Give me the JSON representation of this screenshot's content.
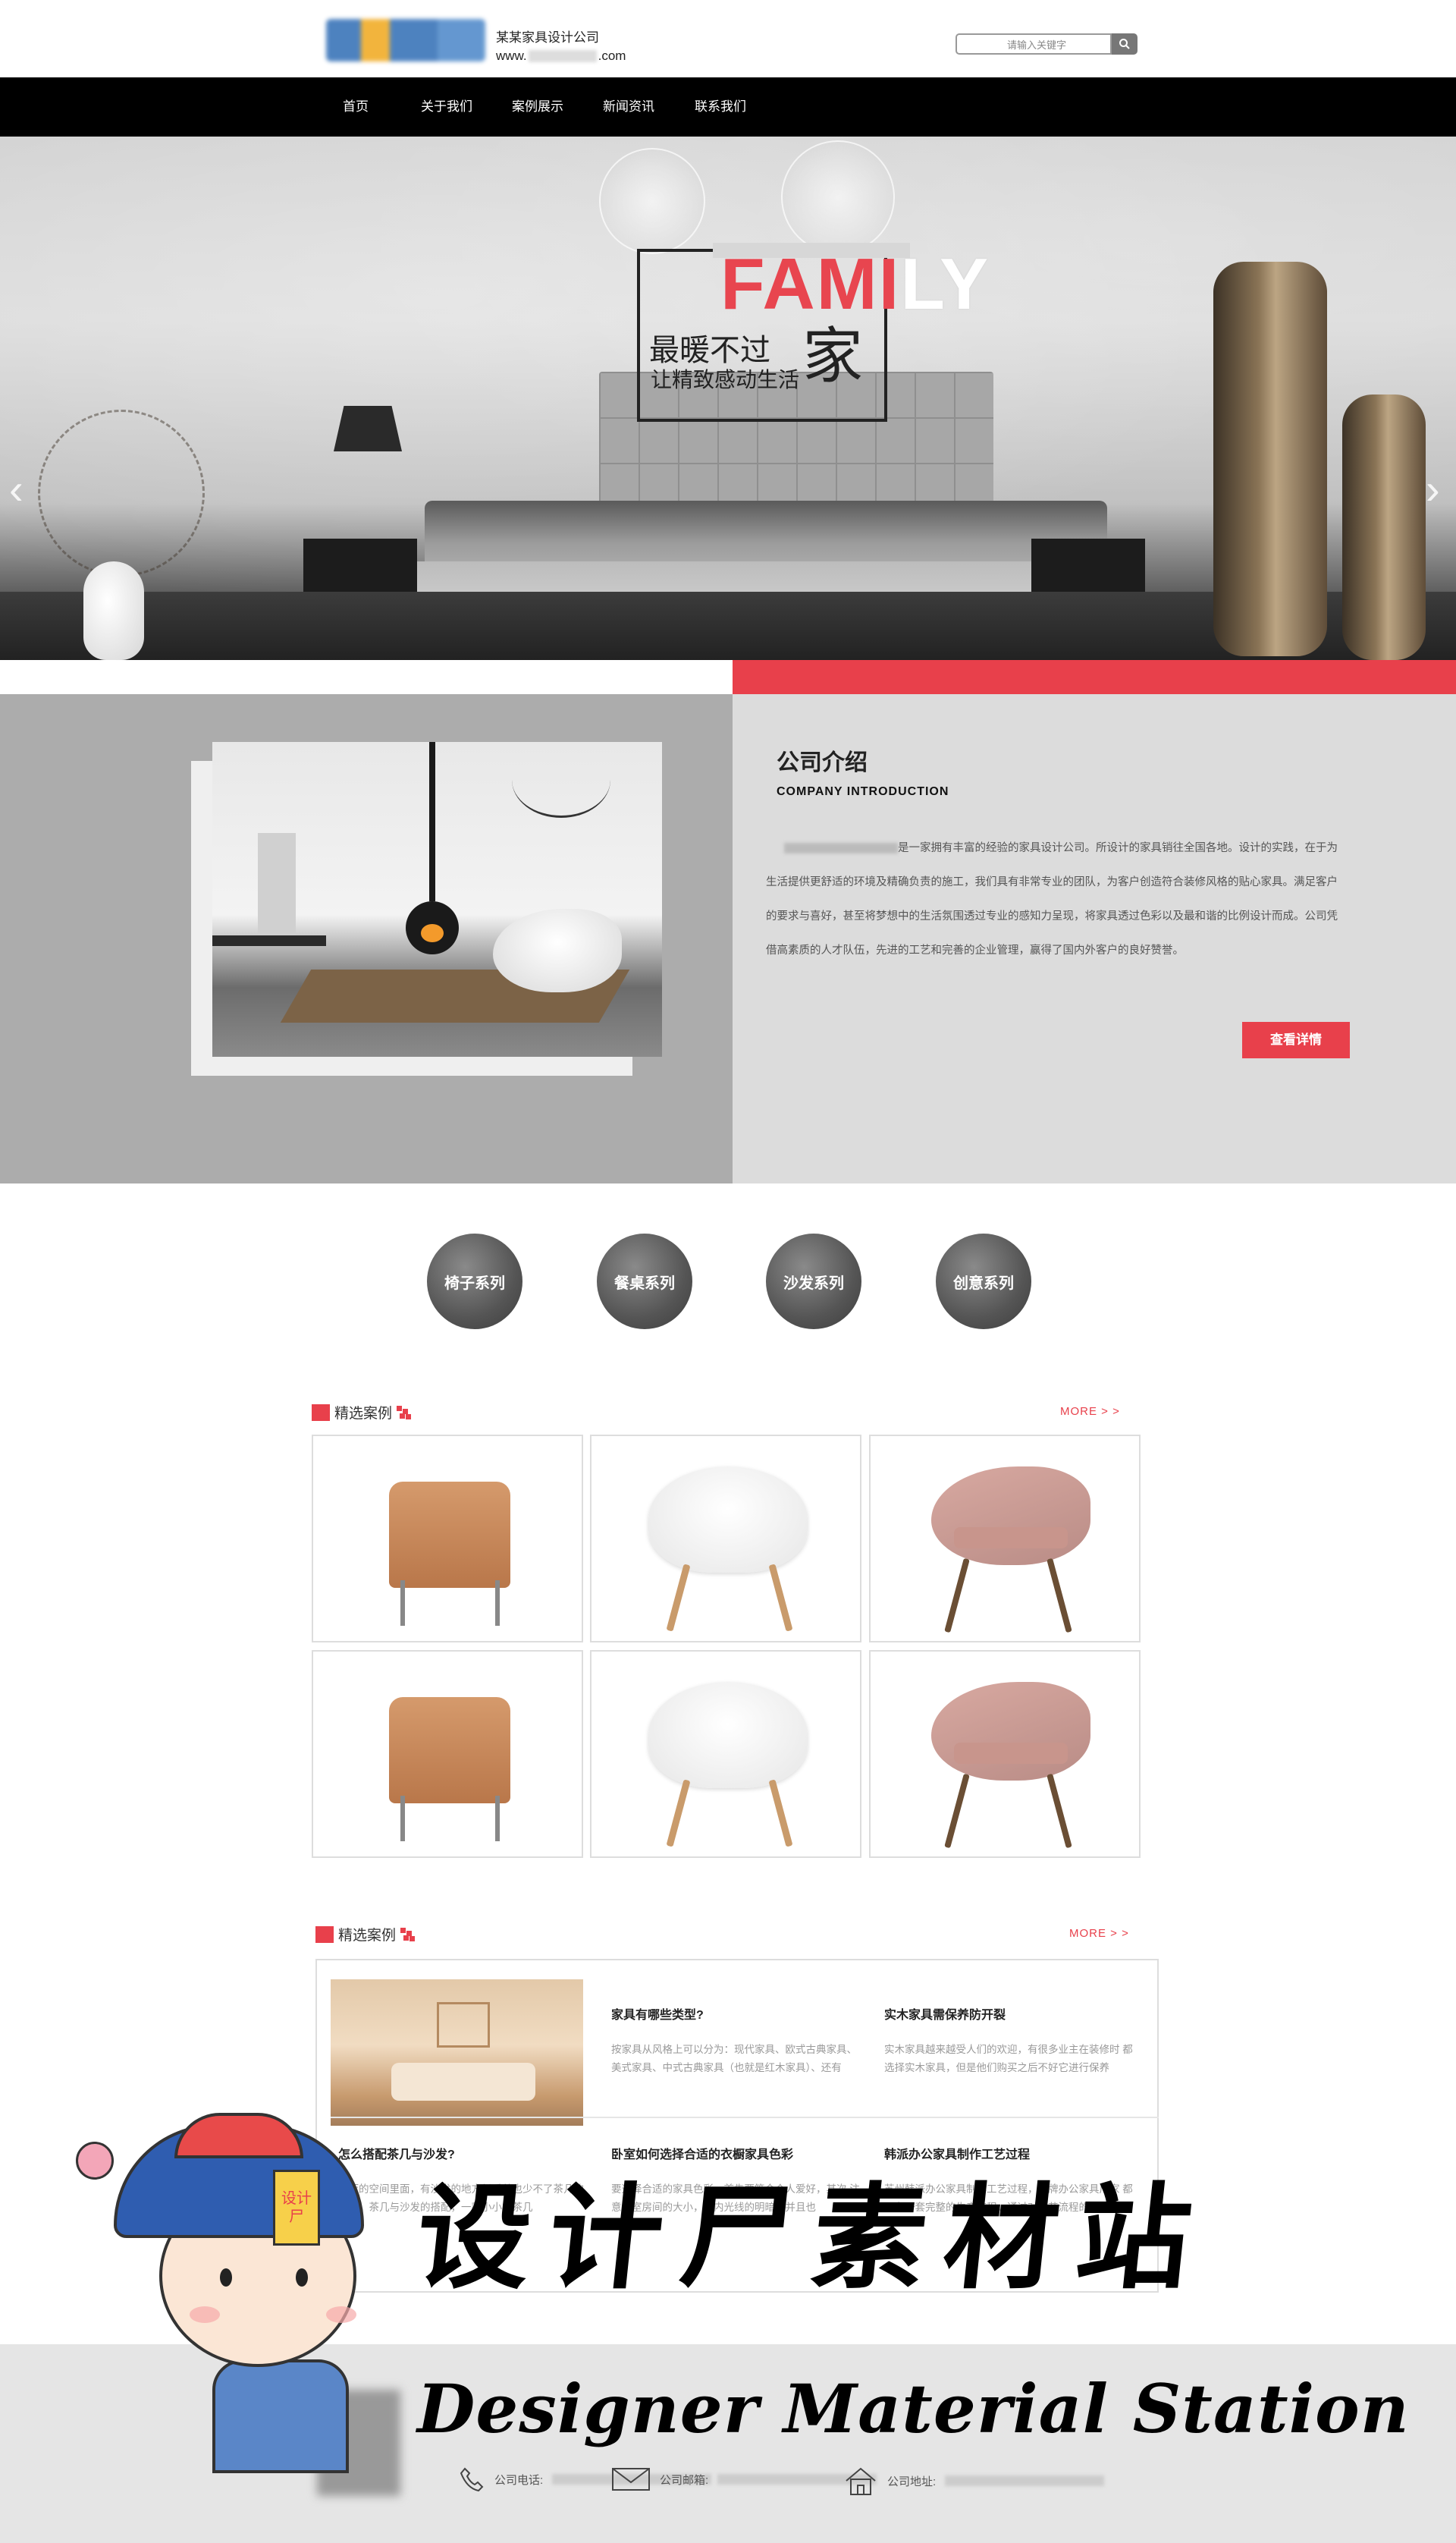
{
  "header": {
    "company_name": "某某家具设计公司",
    "url_prefix": "www.",
    "url_suffix": ".com",
    "search_placeholder": "请输入关键字"
  },
  "nav": {
    "items": [
      "首页",
      "关于我们",
      "案例展示",
      "新闻资讯",
      "联系我们"
    ]
  },
  "banner": {
    "word_red": "FAMI",
    "word_white": "LY",
    "slogan_main": "最暖不过",
    "slogan_big": "家",
    "slogan_sub": "让精致感动生活",
    "prev_arrow": "‹",
    "next_arrow": "›",
    "dots_count": 4
  },
  "intro": {
    "title": "公司介绍",
    "subtitle": "COMPANY INTRODUCTION",
    "paragraph": "是一家拥有丰富的经验的家具设计公司。所设计的家具销往全国各地。设计的实践，在于为生活提供更舒适的环境及精确负责的施工，我们具有非常专业的团队，为客户创造符合装修风格的贴心家具。满足客户的要求与喜好，甚至将梦想中的生活氛围透过专业的感知力呈现，将家具透过色彩以及最和谐的比例设计而成。公司凭借高素质的人才队伍，先进的工艺和完善的企业管理，赢得了国内外客户的良好赞誉。",
    "button_label": "查看详情"
  },
  "categories": [
    "椅子系列",
    "餐桌系列",
    "沙发系列",
    "创意系列"
  ],
  "featured": {
    "title": "精选案例",
    "more": "MORE > >"
  },
  "news": {
    "title": "精选案例",
    "more": "MORE > >",
    "items": [
      {
        "title": "家具有哪些类型?",
        "text": "按家具从风格上可以分为：现代家具、欧式古典家具、美式家具、中式古典家具（也就是红木家具）、还有"
      },
      {
        "title": "实木家具需保养防开裂",
        "text": "实木家具越来越受人们的欢迎，有很多业主在装修时 都选择实木家具，但是他们购买之后不好它进行保养"
      },
      {
        "title": "怎么搭配茶几与沙发?",
        "text": "客厅的空间里面，有沙发的地方似乎总也少不了茶几的身影，茶几与沙发的搭配，一款小小的茶几"
      },
      {
        "title": "卧室如何选择合适的衣橱家具色彩",
        "text": "要选择合适的家具色彩，首先要符合个人爱好，其次 注意卧室房间的大小，室内光线的明暗，并且也"
      },
      {
        "title": "韩派办公家具制作工艺过程",
        "text": "苏州韩派办公家具制作工艺过程，品牌办公家具厂家 都具有一套完整的生产流程，通过对工艺流程的规范以及"
      }
    ]
  },
  "footer": {
    "phone_label": "公司电话:",
    "email_label": "公司邮箱:",
    "address_label": "公司地址:"
  },
  "watermark": {
    "cn": "设计尸素材站",
    "en": "Designer Material Station",
    "tag": "设计尸"
  },
  "colors": {
    "accent": "#e8404b",
    "nav_bg": "#000000",
    "intro_left_bg": "#acacac",
    "intro_right_bg": "#dcdcdc"
  }
}
